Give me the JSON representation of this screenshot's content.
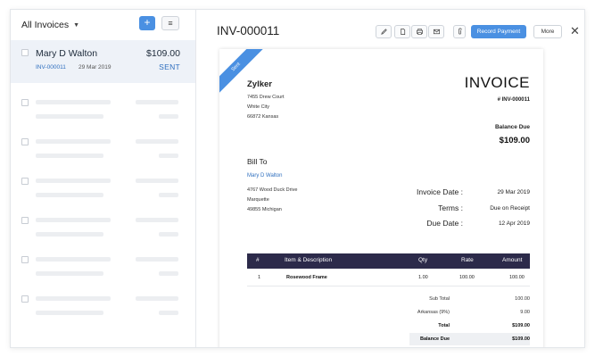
{
  "sidebar": {
    "title": "All Invoices",
    "add_icon": "plus-icon",
    "menu_icon": "hamburger-icon",
    "selected_invoice": {
      "customer": "Mary D Walton",
      "amount": "$109.00",
      "number": "INV-000011",
      "date": "29 Mar 2019",
      "status": "SENT"
    }
  },
  "toolbar": {
    "doc_title": "INV-000011",
    "icons": [
      "edit-icon",
      "pdf-icon",
      "print-icon",
      "email-icon",
      "attachment-icon"
    ],
    "record_payment": "Record Payment",
    "more": "More",
    "close_icon": "close-icon"
  },
  "invoice": {
    "ribbon": "Sent",
    "company": {
      "name": "Zylker",
      "address": [
        "7455 Drew Court",
        "White City",
        "66872 Kansas"
      ]
    },
    "title": "INVOICE",
    "number": "# INV-000011",
    "balance_due_label": "Balance Due",
    "balance_due_value": "$109.00",
    "bill_to_label": "Bill To",
    "customer_name": "Mary D Walton",
    "customer_address": [
      "4767 Wood Duck Drive",
      "Marquette",
      "49855 Michigan"
    ],
    "meta": [
      {
        "label": "Invoice Date :",
        "value": "29 Mar 2019"
      },
      {
        "label": "Terms :",
        "value": "Due on Receipt"
      },
      {
        "label": "Due Date :",
        "value": "12 Apr 2019"
      }
    ],
    "table": {
      "headers": [
        "#",
        "Item & Description",
        "Qty",
        "Rate",
        "Amount"
      ],
      "rows": [
        {
          "num": "1",
          "item": "Rosewood Frame",
          "qty": "1.00",
          "rate": "100.00",
          "amount": "100.00"
        }
      ]
    },
    "totals": [
      {
        "label": "Sub Total",
        "value": "100.00"
      },
      {
        "label": "Arkansas (9%)",
        "value": "9.00"
      },
      {
        "label": "Total",
        "value": "$109.00"
      },
      {
        "label": "Balance Due",
        "value": "$109.00"
      }
    ]
  },
  "colors": {
    "accent": "#4a90e2",
    "table_header": "#2c2a4a",
    "link": "#2f6fbf",
    "selected_row": "#eef2f8"
  }
}
